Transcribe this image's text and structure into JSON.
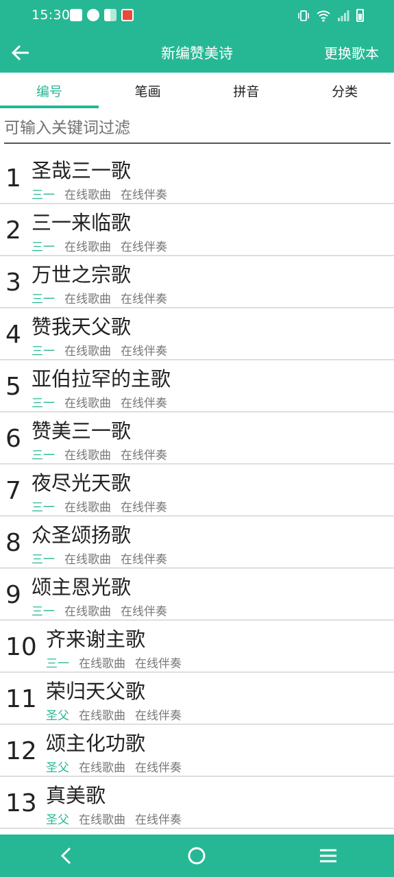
{
  "status_bar": {
    "time": "15:30",
    "icons": [
      "bag-icon",
      "clock-icon",
      "book-icon",
      "apple-icon",
      "vibrate-icon",
      "wifi-icon",
      "signal-icon",
      "battery-icon"
    ]
  },
  "title_bar": {
    "back_icon": "arrow-left-icon",
    "title": "新编赞美诗",
    "change_label": "更换歌本"
  },
  "tabs": [
    {
      "label": "编号",
      "active": true
    },
    {
      "label": "笔画",
      "active": false
    },
    {
      "label": "拼音",
      "active": false
    },
    {
      "label": "分类",
      "active": false
    }
  ],
  "filter": {
    "placeholder": "可输入关键词过滤",
    "value": ""
  },
  "songs": [
    {
      "number": "1",
      "title": "圣哉三一歌",
      "category": "三一",
      "online_song": "在线歌曲",
      "online_accompaniment": "在线伴奏"
    },
    {
      "number": "2",
      "title": "三一来临歌",
      "category": "三一",
      "online_song": "在线歌曲",
      "online_accompaniment": "在线伴奏"
    },
    {
      "number": "3",
      "title": "万世之宗歌",
      "category": "三一",
      "online_song": "在线歌曲",
      "online_accompaniment": "在线伴奏"
    },
    {
      "number": "4",
      "title": "赞我天父歌",
      "category": "三一",
      "online_song": "在线歌曲",
      "online_accompaniment": "在线伴奏"
    },
    {
      "number": "5",
      "title": "亚伯拉罕的主歌",
      "category": "三一",
      "online_song": "在线歌曲",
      "online_accompaniment": "在线伴奏"
    },
    {
      "number": "6",
      "title": "赞美三一歌",
      "category": "三一",
      "online_song": "在线歌曲",
      "online_accompaniment": "在线伴奏"
    },
    {
      "number": "7",
      "title": "夜尽光天歌",
      "category": "三一",
      "online_song": "在线歌曲",
      "online_accompaniment": "在线伴奏"
    },
    {
      "number": "8",
      "title": "众圣颂扬歌",
      "category": "三一",
      "online_song": "在线歌曲",
      "online_accompaniment": "在线伴奏"
    },
    {
      "number": "9",
      "title": "颂主恩光歌",
      "category": "三一",
      "online_song": "在线歌曲",
      "online_accompaniment": "在线伴奏"
    },
    {
      "number": "10",
      "title": "齐来谢主歌",
      "category": "三一",
      "online_song": "在线歌曲",
      "online_accompaniment": "在线伴奏"
    },
    {
      "number": "11",
      "title": "荣归天父歌",
      "category": "圣父",
      "online_song": "在线歌曲",
      "online_accompaniment": "在线伴奏"
    },
    {
      "number": "12",
      "title": "颂主化功歌",
      "category": "圣父",
      "online_song": "在线歌曲",
      "online_accompaniment": "在线伴奏"
    },
    {
      "number": "13",
      "title": "真美歌",
      "category": "圣父",
      "online_song": "在线歌曲",
      "online_accompaniment": "在线伴奏"
    }
  ],
  "nav_bar": {
    "icons": [
      "back-nav-icon",
      "home-nav-icon",
      "menu-nav-icon"
    ]
  },
  "colors": {
    "accent": "#26b894",
    "text": "#222222",
    "muted": "#777777",
    "divider": "#dedede"
  }
}
